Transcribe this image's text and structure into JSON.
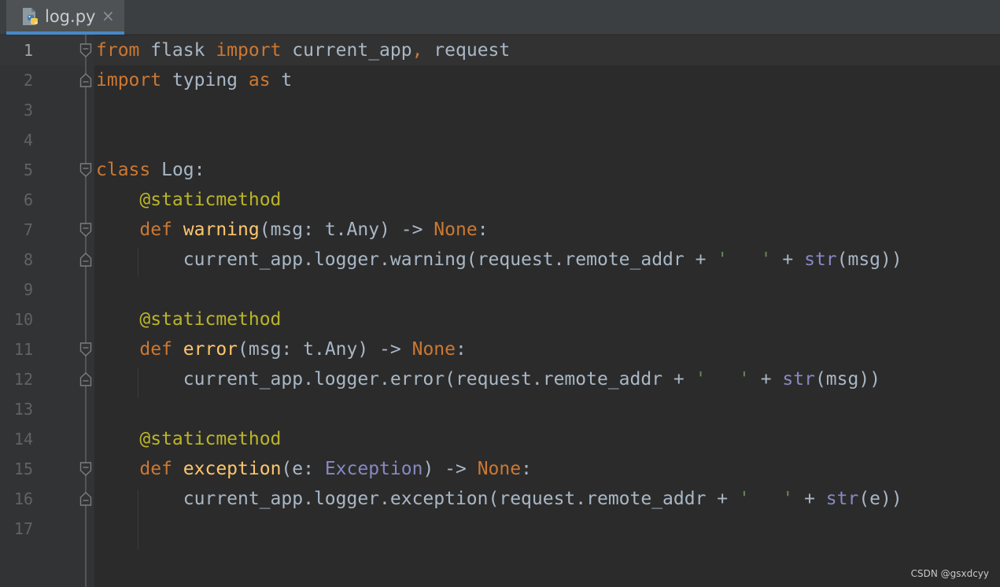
{
  "tab": {
    "title": "log.py",
    "close_glyph": "×",
    "icon": "python-file-icon"
  },
  "colors": {
    "keyword": "#cc7832",
    "decorator": "#bbb529",
    "function": "#ffc66d",
    "builtin": "#8888c6",
    "default": "#a9b7c6",
    "background": "#2b2b2b",
    "gutter": "#313335",
    "tab_accent": "#4a88c7"
  },
  "lines": [
    {
      "n": "1",
      "tokens": [
        {
          "t": "from",
          "c": "kw"
        },
        {
          "t": " flask ",
          "c": ""
        },
        {
          "t": "import",
          "c": "kw"
        },
        {
          "t": " current_app",
          "c": ""
        },
        {
          "t": ",",
          "c": "kw"
        },
        {
          "t": " request",
          "c": ""
        }
      ]
    },
    {
      "n": "2",
      "tokens": [
        {
          "t": "import",
          "c": "kw"
        },
        {
          "t": " typing ",
          "c": ""
        },
        {
          "t": "as",
          "c": "kw"
        },
        {
          "t": " t",
          "c": ""
        }
      ]
    },
    {
      "n": "3",
      "tokens": []
    },
    {
      "n": "4",
      "tokens": []
    },
    {
      "n": "5",
      "tokens": [
        {
          "t": "class",
          "c": "kw"
        },
        {
          "t": " Log:",
          "c": ""
        }
      ]
    },
    {
      "n": "6",
      "tokens": [
        {
          "t": "    ",
          "c": ""
        },
        {
          "t": "@staticmethod",
          "c": "dec"
        }
      ]
    },
    {
      "n": "7",
      "tokens": [
        {
          "t": "    ",
          "c": ""
        },
        {
          "t": "def",
          "c": "kw"
        },
        {
          "t": " ",
          "c": ""
        },
        {
          "t": "warning",
          "c": "fn"
        },
        {
          "t": "(msg: t.Any) -> ",
          "c": ""
        },
        {
          "t": "None",
          "c": "kw"
        },
        {
          "t": ":",
          "c": ""
        }
      ]
    },
    {
      "n": "8",
      "tokens": [
        {
          "t": "        current_app.logger.warning(request.remote_addr + ",
          "c": ""
        },
        {
          "t": "'   '",
          "c": "str"
        },
        {
          "t": " + ",
          "c": ""
        },
        {
          "t": "str",
          "c": "bi"
        },
        {
          "t": "(msg))",
          "c": ""
        }
      ]
    },
    {
      "n": "9",
      "tokens": []
    },
    {
      "n": "10",
      "tokens": [
        {
          "t": "    ",
          "c": ""
        },
        {
          "t": "@staticmethod",
          "c": "dec"
        }
      ]
    },
    {
      "n": "11",
      "tokens": [
        {
          "t": "    ",
          "c": ""
        },
        {
          "t": "def",
          "c": "kw"
        },
        {
          "t": " ",
          "c": ""
        },
        {
          "t": "error",
          "c": "fn"
        },
        {
          "t": "(msg: t.Any) -> ",
          "c": ""
        },
        {
          "t": "None",
          "c": "kw"
        },
        {
          "t": ":",
          "c": ""
        }
      ]
    },
    {
      "n": "12",
      "tokens": [
        {
          "t": "        current_app.logger.error(request.remote_addr + ",
          "c": ""
        },
        {
          "t": "'   '",
          "c": "str"
        },
        {
          "t": " + ",
          "c": ""
        },
        {
          "t": "str",
          "c": "bi"
        },
        {
          "t": "(msg))",
          "c": ""
        }
      ]
    },
    {
      "n": "13",
      "tokens": []
    },
    {
      "n": "14",
      "tokens": [
        {
          "t": "    ",
          "c": ""
        },
        {
          "t": "@staticmethod",
          "c": "dec"
        }
      ]
    },
    {
      "n": "15",
      "tokens": [
        {
          "t": "    ",
          "c": ""
        },
        {
          "t": "def",
          "c": "kw"
        },
        {
          "t": " ",
          "c": ""
        },
        {
          "t": "exception",
          "c": "fn"
        },
        {
          "t": "(e: ",
          "c": ""
        },
        {
          "t": "Exception",
          "c": "bi"
        },
        {
          "t": ") -> ",
          "c": ""
        },
        {
          "t": "None",
          "c": "kw"
        },
        {
          "t": ":",
          "c": ""
        }
      ]
    },
    {
      "n": "16",
      "tokens": [
        {
          "t": "        current_app.logger.exception(request.remote_addr + ",
          "c": ""
        },
        {
          "t": "'   '",
          "c": "str"
        },
        {
          "t": " + ",
          "c": ""
        },
        {
          "t": "str",
          "c": "bi"
        },
        {
          "t": "(e))",
          "c": ""
        }
      ]
    },
    {
      "n": "17",
      "tokens": []
    }
  ],
  "folds": {
    "1": "start",
    "2": "end",
    "5": "start",
    "7": "start",
    "8": "end",
    "11": "start",
    "12": "end",
    "15": "start",
    "16": "end"
  },
  "watermark": "CSDN @gsxdcyy"
}
